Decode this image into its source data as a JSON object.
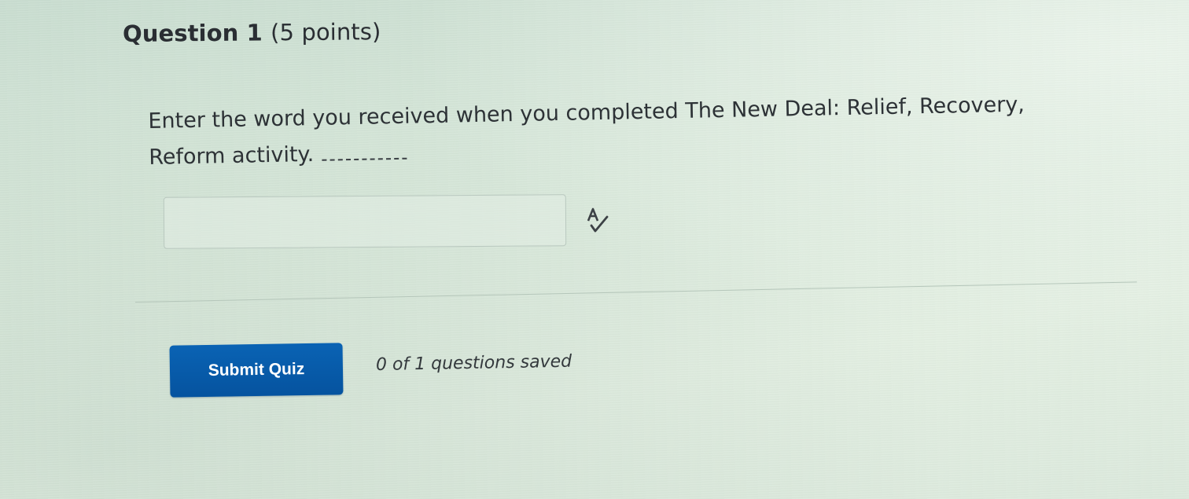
{
  "question": {
    "title": "Question 1",
    "points": "(5 points)",
    "text": "Enter the word you received when you completed The New Deal: Relief, Recovery, Reform activity.",
    "blank": "________"
  },
  "answer": {
    "value": "",
    "placeholder": ""
  },
  "icons": {
    "spellcheck": "spellcheck-icon"
  },
  "footer": {
    "submit_label": "Submit Quiz",
    "save_status": "0 of 1 questions saved"
  },
  "colors": {
    "accent": "#0a5aa8",
    "background": "#d6e7d8",
    "text": "#2b2f33"
  }
}
